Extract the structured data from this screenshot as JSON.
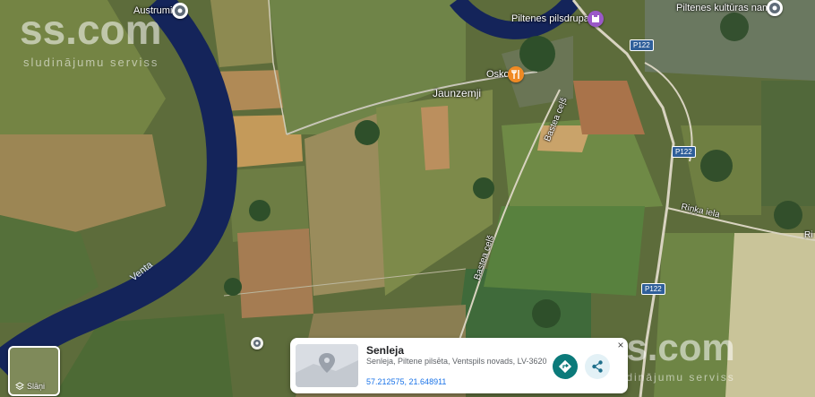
{
  "places": {
    "austrumi": "Austrumi",
    "pilsdrupas": "Piltenes pilsdrupas",
    "kulturas_nams": "Piltenes kultūras nams",
    "osko": "Osko",
    "jaunzemji": "Jaunzemji"
  },
  "roads": {
    "bastea_1": "Bastea ceļš",
    "bastea_2": "Bastea ceļš",
    "rinka": "Riņķa iela",
    "edge_r": "Ri",
    "p122_a": "P122",
    "p122_b": "P122",
    "p122_c": "P122"
  },
  "river": "Venta",
  "watermark": {
    "brand": "ss.com",
    "tagline": "sludinājumu serviss",
    "brand_br": "ss.com",
    "tagline_br": "sludinājumu serviss"
  },
  "layers": {
    "label": "Slāņi"
  },
  "card": {
    "title": "Senleja",
    "address": "Senleja, Piltene pilsēta, Ventspils novads, LV-3620",
    "coords": "57.212575, 21.648911",
    "close": "×"
  },
  "colors": {
    "river": "#14245a",
    "field_green": "#5f7a3a",
    "field_brown": "#a98754",
    "directions_btn": "#0b7a7a",
    "share_btn": "#e3f1f6",
    "poi_orange": "#f08a24",
    "poi_purple": "#9a58c8"
  }
}
